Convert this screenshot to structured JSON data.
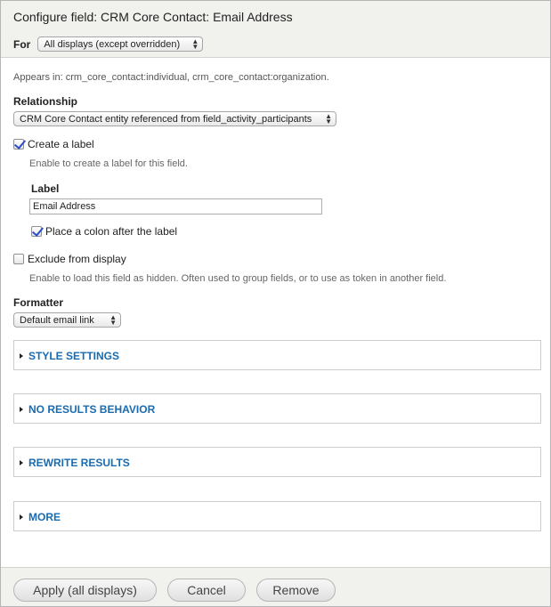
{
  "dialog": {
    "title": "Configure field: CRM Core Contact: Email Address",
    "for_label": "For",
    "for_select": "All displays (except overridden)"
  },
  "appears_in": "Appears in: crm_core_contact:individual, crm_core_contact:organization.",
  "relationship": {
    "label": "Relationship",
    "select": "CRM Core Contact entity referenced from field_activity_participants"
  },
  "create_label": {
    "checkbox_label": "Create a label",
    "checked": true,
    "description": "Enable to create a label for this field.",
    "label_heading": "Label",
    "label_value": "Email Address",
    "colon_label": "Place a colon after the label",
    "colon_checked": true
  },
  "exclude": {
    "checkbox_label": "Exclude from display",
    "checked": false,
    "description": "Enable to load this field as hidden. Often used to group fields, or to use as token in another field."
  },
  "formatter": {
    "label": "Formatter",
    "select": "Default email link"
  },
  "fieldsets": [
    {
      "label": "STYLE SETTINGS"
    },
    {
      "label": "NO RESULTS BEHAVIOR"
    },
    {
      "label": "REWRITE RESULTS"
    },
    {
      "label": "MORE"
    }
  ],
  "buttons": {
    "apply": "Apply (all displays)",
    "cancel": "Cancel",
    "remove": "Remove"
  },
  "colors": {
    "link_blue": "#1a6bb0",
    "header_bg": "#f1f1ed"
  }
}
